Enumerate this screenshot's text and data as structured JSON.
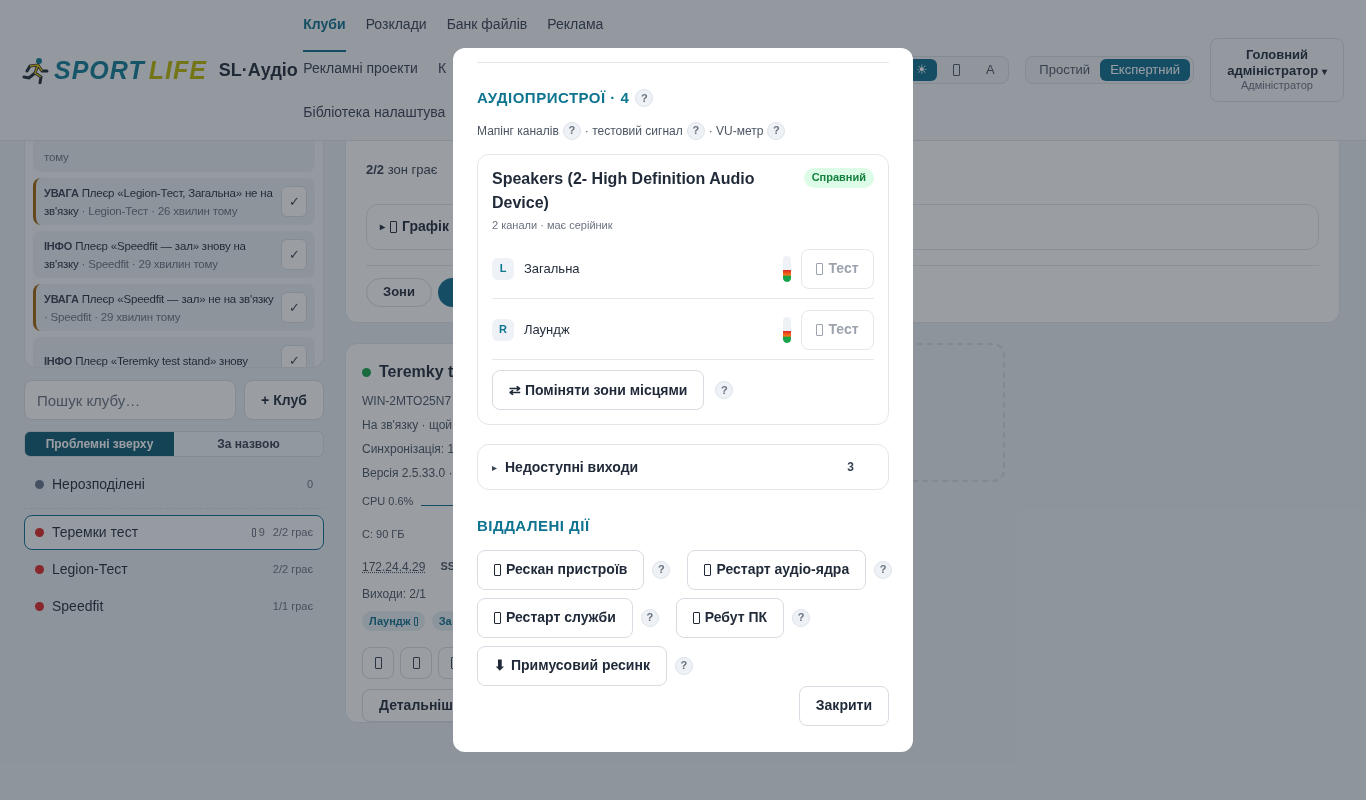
{
  "header": {
    "logo": {
      "word_1": "SPORT",
      "word_2": "LIFE"
    },
    "app_name": "SL·Аудіо",
    "nav_rows": [
      [
        {
          "label": "Клуби",
          "selected": true
        },
        {
          "label": "Розклади",
          "selected": false
        },
        {
          "label": "Банк файлів",
          "selected": false
        },
        {
          "label": "Реклама",
          "selected": false
        }
      ],
      [
        {
          "label": "Рекламні проекти",
          "selected": false
        },
        {
          "label": "К",
          "selected": false
        }
      ],
      [
        {
          "label": "Бібліотека налаштува",
          "selected": false
        }
      ]
    ],
    "theme_options": [
      {
        "kind": "sun",
        "label": "☀",
        "selected": true
      },
      {
        "kind": "glyph",
        "selected": false
      },
      {
        "kind": "text",
        "label": "A",
        "selected": false
      }
    ],
    "mode_options": [
      {
        "label": "Простий",
        "selected": false
      },
      {
        "label": "Експертний",
        "selected": true
      }
    ],
    "user": {
      "name": "Головний адміністратор",
      "caret": "▾",
      "role": "Адміністратор"
    }
  },
  "sidebar": {
    "alerts": [
      {
        "kind": "cut",
        "meta": "тому"
      },
      {
        "kind": "warning",
        "tag": "УВАГА",
        "message": "Плеєр «Legion-Тест, Загальна» не на зв'язку",
        "meta": " · Legion-Тест · 26 хвилин тому",
        "check": "✓"
      },
      {
        "kind": "info",
        "tag": "ІНФО",
        "message": "Плеєр «Speedfit — зал» знову на зв'язку",
        "meta": " · Speedfit · 29 хвилин тому",
        "check": "✓"
      },
      {
        "kind": "warning",
        "tag": "УВАГА",
        "message": "Плеєр «Speedfit — зал» не на зв'язку",
        "meta": " · Speedfit · 29 хвилин тому",
        "check": "✓"
      },
      {
        "kind": "info",
        "tag": "ІНФО",
        "message": "Плеєр «Teremky test stand» знову",
        "check": "✓"
      }
    ],
    "search": {
      "placeholder": "Пошук клубу…"
    },
    "add_button": "+ Клуб",
    "sort_tabs": [
      {
        "label": "Проблемні зверху",
        "selected": true
      },
      {
        "label": "За назвою",
        "selected": false
      }
    ],
    "unassigned": {
      "name": "Нерозподілені",
      "count": "0"
    },
    "clubs": [
      {
        "name": "Теремки тест",
        "alerts": "9",
        "status": "2/2 грає",
        "problem": true,
        "selected": true
      },
      {
        "name": "Legion-Тест",
        "status": "2/2 грає",
        "problem": true,
        "selected": false
      },
      {
        "name": "Speedfit",
        "status": "1/1 грає",
        "problem": true,
        "selected": false
      }
    ]
  },
  "club_panel": {
    "zones_playing": {
      "count": "2/2",
      "text": "зон грає"
    },
    "schedule_toggle": {
      "arrow": "▸",
      "label": "Графік"
    },
    "zones_button": "Зони"
  },
  "player_card": {
    "connected": true,
    "name": "Teremky t",
    "host": "WIN-2MTO25N7",
    "online": "На зв'язку · щой",
    "sync": "Синхронізація: 1",
    "version": "Версія 2.5.33.0 ·",
    "cpu": "CPU 0.6%",
    "disk": "C: 90 ГБ",
    "ip": "172.24.4.29",
    "ssh": "SS",
    "outputs": "Виходи: 2/1",
    "chips": [
      "Лаундж",
      "За"
    ],
    "details_button": "Детальніш"
  },
  "modal": {
    "audio_title": "АУДІОПРИСТРОЇ · 4",
    "help": "?",
    "subtitle": [
      {
        "text": "Мапінг каналів"
      },
      {
        "text": "· тестовий сигнал"
      },
      {
        "text": "· VU-метр"
      }
    ],
    "device": {
      "name": "Speakers (2- High Definition Audio Device)",
      "badge": "Справний",
      "details": "2 канали · має серійник",
      "channels": [
        {
          "side": "L",
          "zone": "Загальна",
          "level": 0.45,
          "test": "Тест",
          "disabled": true
        },
        {
          "side": "R",
          "zone": "Лаундж",
          "level": 0.45,
          "test": "Тест",
          "disabled": true
        }
      ],
      "swap_button": "⇄ Поміняти зони місцями"
    },
    "unavailable": {
      "arrow": "▸",
      "label": "Недоступні виходи",
      "count": "3"
    },
    "actions_title": "ВІДДАЛЕНІ ДІЇ",
    "actions": [
      [
        {
          "kind": "boxed",
          "label": "Рескан пристроїв"
        },
        {
          "kind": "boxed",
          "label": "Рестарт аудіо-ядра"
        }
      ],
      [
        {
          "kind": "boxed",
          "label": "Рестарт служби"
        },
        {
          "kind": "boxed",
          "label": "Ребут ПК"
        }
      ],
      [
        {
          "kind": "arrow",
          "glyph": "⬇",
          "label": "Примусовий ресинк"
        }
      ]
    ],
    "close_button": "Закрити"
  }
}
